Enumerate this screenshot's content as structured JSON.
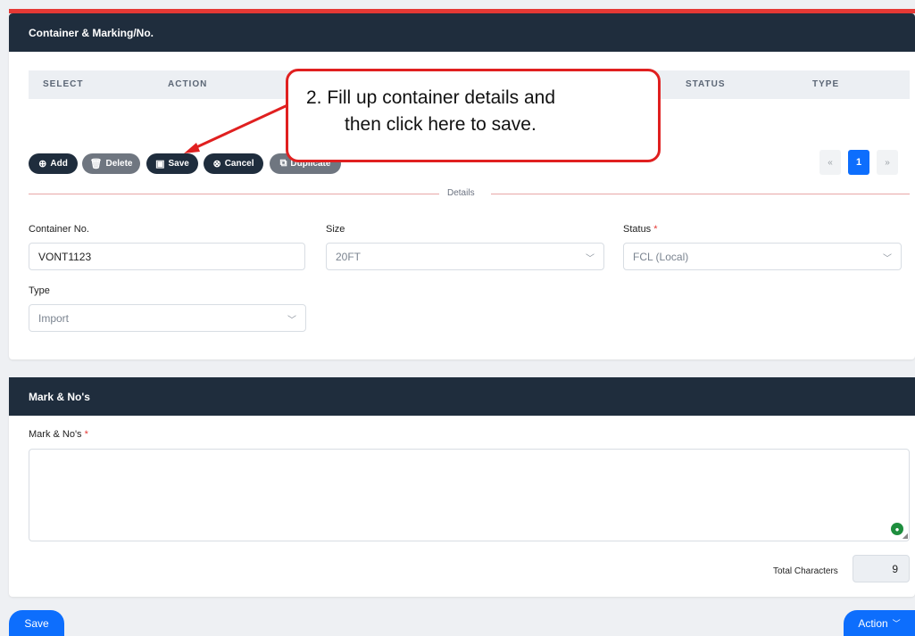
{
  "section1": {
    "title": "Container & Marking/No.",
    "columns": [
      "SELECT",
      "ACTION",
      "STATUS",
      "TYPE"
    ],
    "buttons": {
      "add": "Add",
      "delete": "Delete",
      "save": "Save",
      "cancel": "Cancel",
      "duplicate": "Duplicate"
    },
    "pagination": {
      "prev": "«",
      "current": "1",
      "next": "»"
    },
    "details_label": "Details",
    "form": {
      "container_no_label": "Container No.",
      "container_no_value": "VONT1123",
      "size_label": "Size",
      "size_value": "20FT",
      "status_label": "Status",
      "status_value": "FCL (Local)",
      "type_label": "Type",
      "type_value": "Import"
    }
  },
  "section2": {
    "title": "Mark & No's",
    "mark_label": "Mark & No's",
    "mark_value": "",
    "total_label": "Total Characters",
    "total_value": "9"
  },
  "footer": {
    "save": "Save",
    "action": "Action"
  },
  "annotation": {
    "line1": "2.  Fill up container details and",
    "line2": "then click here to save."
  },
  "colors": {
    "header": "#1f2d3d",
    "primary": "#0d6efd",
    "accent_red": "#e53935"
  }
}
